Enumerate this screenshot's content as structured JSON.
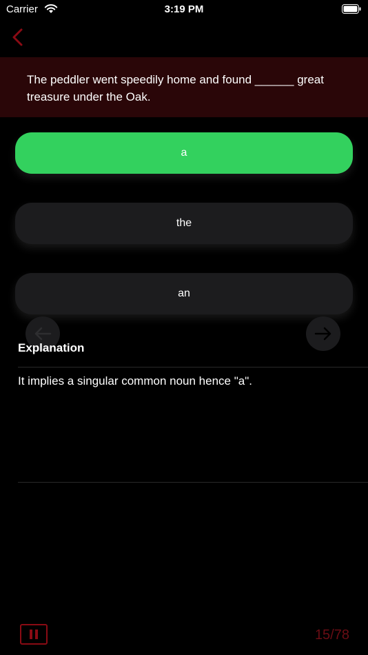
{
  "status_bar": {
    "carrier": "Carrier",
    "time": "3:19 PM"
  },
  "question": {
    "text": "The peddler went speedily home and found ______ great treasure under the Oak."
  },
  "options": [
    {
      "label": "a",
      "state": "correct"
    },
    {
      "label": "the",
      "state": "default"
    },
    {
      "label": "an",
      "state": "default"
    }
  ],
  "explanation": {
    "heading": "Explanation",
    "text": "It implies a singular common noun hence \"a\"."
  },
  "footer": {
    "progress": "15/78"
  },
  "icons": {
    "back": "chevron-left-icon",
    "prev": "arrow-left-icon",
    "next": "arrow-right-icon",
    "pause": "pause-icon",
    "wifi": "wifi-icon",
    "battery": "battery-icon"
  },
  "colors": {
    "background": "#000000",
    "banner": "#2a0608",
    "correct": "#33d15e",
    "option": "#1c1c1e",
    "accent": "#8a0b14"
  }
}
